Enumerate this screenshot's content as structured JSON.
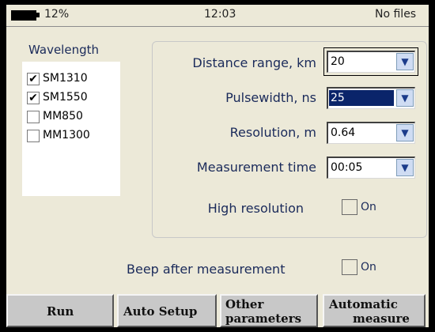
{
  "status": {
    "battery": "12%",
    "time": "12:03",
    "files": "No files"
  },
  "wavelength": {
    "title": "Wavelength",
    "items": [
      {
        "label": "SM1310",
        "checked": true
      },
      {
        "label": "SM1550",
        "checked": true
      },
      {
        "label": "MM850",
        "checked": false
      },
      {
        "label": "MM1300",
        "checked": false
      }
    ]
  },
  "settings": {
    "distance_range": {
      "label": "Distance range, km",
      "value": "20"
    },
    "pulsewidth": {
      "label": "Pulsewidth, ns",
      "value": "25"
    },
    "resolution": {
      "label": "Resolution, m",
      "value": "0.64"
    },
    "measurement_time": {
      "label": "Measurement time",
      "value": "00:05"
    },
    "high_resolution": {
      "label": "High resolution",
      "toggle_label": "On"
    }
  },
  "beep": {
    "label": "Beep after measurement",
    "toggle_label": "On"
  },
  "buttons": {
    "run": "Run",
    "auto_setup": "Auto Setup",
    "other_line1": "Other",
    "other_line2": "parameters",
    "automatic_line1": "Automatic",
    "automatic_line2": "measure"
  },
  "check_mark": "✔",
  "dropdown_icon": "chevron-down-icon"
}
